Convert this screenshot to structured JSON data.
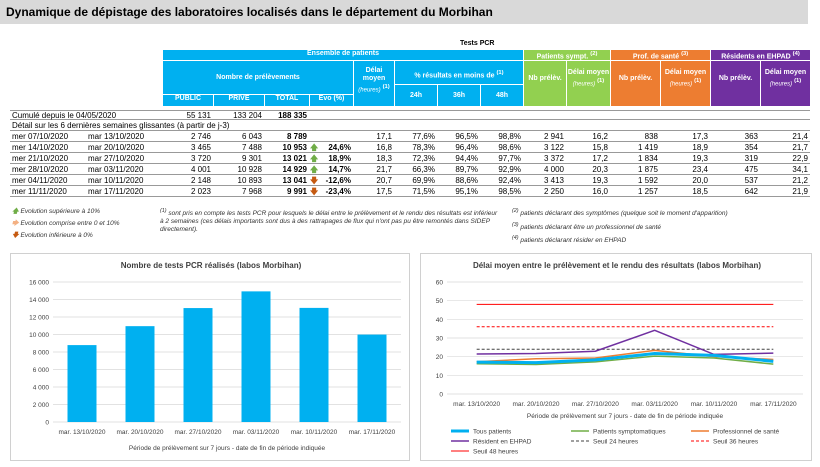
{
  "title": "Dynamique de dépistage des laboratoires localisés dans le département du Morbihan",
  "table": {
    "title": "Tests PCR",
    "groups": {
      "ensemble": "Ensemble de patients",
      "symptomatiques": "Patients sympt.",
      "symptomatiques_sup": "(2)",
      "sante": "Prof. de santé",
      "sante_sup": "(3)",
      "ehpad": "Résidents en EHPAD",
      "ehpad_sup": "(4)"
    },
    "headers": {
      "nb_prelevements": "Nombre de prélèvements",
      "delai": "Délai moyen",
      "heures": "(heures)",
      "sup1": "(1)",
      "pct_moins": "% résultats en moins de",
      "public": "PUBLIC",
      "prive": "PRIVE",
      "total": "TOTAL",
      "evo": "Evo (%)",
      "h24": "24h",
      "h36": "36h",
      "h48": "48h",
      "nb_prelev": "Nb prélèv.",
      "delai_moyen": "Délai moyen"
    },
    "cumul": {
      "label": "Cumulé depuis le 04/05/2020",
      "public": "55 131",
      "prive": "133 204",
      "total": "188 335"
    },
    "detail_label": "Détail sur les 6 dernières semaines glissantes (à partir de j-3)",
    "rows": [
      {
        "from": "mer 07/10/2020",
        "to": "mar 13/10/2020",
        "public": "2 746",
        "prive": "6 043",
        "total": "8 789",
        "evo": "",
        "arrow": "",
        "delai": "17,1",
        "p24": "77,6%",
        "p36": "96,5%",
        "p48": "98,8%",
        "s_nb": "2 941",
        "s_delai": "16,2",
        "ps_nb": "838",
        "ps_delai": "17,3",
        "e_nb": "363",
        "e_delai": "21,4"
      },
      {
        "from": "mer 14/10/2020",
        "to": "mar 20/10/2020",
        "public": "3 465",
        "prive": "7 488",
        "total": "10 953",
        "evo": "24,6%",
        "arrow": "up",
        "delai": "16,8",
        "p24": "78,3%",
        "p36": "96,4%",
        "p48": "98,6%",
        "s_nb": "3 122",
        "s_delai": "15,8",
        "ps_nb": "1 419",
        "ps_delai": "18,9",
        "e_nb": "354",
        "e_delai": "21,7"
      },
      {
        "from": "mer 21/10/2020",
        "to": "mar 27/10/2020",
        "public": "3 720",
        "prive": "9 301",
        "total": "13 021",
        "evo": "18,9%",
        "arrow": "up",
        "delai": "18,3",
        "p24": "72,3%",
        "p36": "94,4%",
        "p48": "97,7%",
        "s_nb": "3 372",
        "s_delai": "17,2",
        "ps_nb": "1 834",
        "ps_delai": "19,3",
        "e_nb": "319",
        "e_delai": "22,9"
      },
      {
        "from": "mer 28/10/2020",
        "to": "mar 03/11/2020",
        "public": "4 001",
        "prive": "10 928",
        "total": "14 929",
        "evo": "14,7%",
        "arrow": "up",
        "delai": "21,7",
        "p24": "66,3%",
        "p36": "89,7%",
        "p48": "92,9%",
        "s_nb": "4 000",
        "s_delai": "20,3",
        "ps_nb": "1 875",
        "ps_delai": "23,4",
        "e_nb": "475",
        "e_delai": "34,1"
      },
      {
        "from": "mer 04/11/2020",
        "to": "mar 10/11/2020",
        "public": "2 148",
        "prive": "10 893",
        "total": "13 041",
        "evo": "-12,6%",
        "arrow": "down",
        "delai": "20,7",
        "p24": "69,9%",
        "p36": "88,6%",
        "p48": "92,4%",
        "s_nb": "3 413",
        "s_delai": "19,3",
        "ps_nb": "1 592",
        "ps_delai": "20,0",
        "e_nb": "537",
        "e_delai": "21,2"
      },
      {
        "from": "mer 11/11/2020",
        "to": "mar 17/11/2020",
        "public": "2 023",
        "prive": "7 968",
        "total": "9 991",
        "evo": "-23,4%",
        "arrow": "down",
        "delai": "17,5",
        "p24": "71,5%",
        "p36": "95,1%",
        "p48": "98,5%",
        "s_nb": "2 250",
        "s_delai": "16,0",
        "ps_nb": "1 257",
        "ps_delai": "18,5",
        "e_nb": "642",
        "e_delai": "21,9"
      }
    ]
  },
  "legend_left": {
    "up": "Evolution supérieure à 10%",
    "mid": "Evolution comprise entre 0 et 10%",
    "down": "Evolution inférieure à 0%"
  },
  "notes": {
    "n1_mark": "(1)",
    "n1": "sont pris en compte les tests PCR pour lesquels le délai entre le prélèvement et le rendu des résultats est inférieur à 2 semaines (ces délais importants sont dus à des rattrapages de flux qui n'ont pas pu être remontés dans SIDEP directement).",
    "n2_mark": "(2)",
    "n2": "patients déclarant des symptômes (quelque soit le moment d'apparition)",
    "n3_mark": "(3)",
    "n3": "patients déclarant être un professionnel de santé",
    "n4_mark": "(4)",
    "n4": "patients déclarant résider en EHPAD"
  },
  "colors": {
    "blue": "#00b0f0",
    "green": "#92d050",
    "orange": "#ed7d31",
    "purple": "#7030a0",
    "bar": "#00b0f0"
  },
  "chart_data": [
    {
      "type": "bar",
      "title": "Nombre de tests PCR réalisés (labos Morbihan)",
      "xlabel": "Période de prélèvement sur 7 jours - date de fin de période indiquée",
      "ylabel": "",
      "categories": [
        "mar. 13/10/2020",
        "mar. 20/10/2020",
        "mar. 27/10/2020",
        "mar. 03/11/2020",
        "mar. 10/11/2020",
        "mar. 17/11/2020"
      ],
      "values": [
        8789,
        10953,
        13021,
        14929,
        13041,
        9991
      ],
      "ylim": [
        0,
        16000
      ],
      "yticks": [
        0,
        2000,
        4000,
        6000,
        8000,
        10000,
        12000,
        14000,
        16000
      ],
      "ytick_labels": [
        "0",
        "2 000",
        "4 000",
        "6 000",
        "8 000",
        "10 000",
        "12 000",
        "14 000",
        "16 000"
      ],
      "grid": true
    },
    {
      "type": "line",
      "title": "Délai moyen entre le prélèvement et le rendu des résultats (labos Morbihan)",
      "xlabel": "Période de prélèvement sur 7 jours - date de fin de période indiquée",
      "ylabel": "",
      "categories": [
        "mar. 13/10/2020",
        "mar. 20/10/2020",
        "mar. 27/10/2020",
        "mar. 03/11/2020",
        "mar. 10/11/2020",
        "mar. 17/11/2020"
      ],
      "ylim": [
        0,
        60
      ],
      "yticks": [
        0,
        10,
        20,
        30,
        40,
        50,
        60
      ],
      "grid": true,
      "legend": "bottom",
      "series": [
        {
          "name": "Tous patients",
          "values": [
            17.1,
            16.8,
            18.3,
            21.7,
            20.7,
            17.5
          ],
          "color": "#00b0f0",
          "style": "solid",
          "width": 3
        },
        {
          "name": "Patients symptomatiques",
          "values": [
            16.2,
            15.8,
            17.2,
            20.3,
            19.3,
            16.0
          ],
          "color": "#70ad47",
          "style": "solid",
          "width": 1.5
        },
        {
          "name": "Professionnel de santé",
          "values": [
            17.3,
            18.9,
            19.3,
            23.4,
            20.0,
            18.5
          ],
          "color": "#ed7d31",
          "style": "solid",
          "width": 1.5
        },
        {
          "name": "Résident en EHPAD",
          "values": [
            21.4,
            21.7,
            22.9,
            34.1,
            21.2,
            21.9
          ],
          "color": "#7030a0",
          "style": "solid",
          "width": 1.5
        },
        {
          "name": "Seuil 24 heures",
          "values": [
            24,
            24,
            24,
            24,
            24,
            24
          ],
          "color": "#404040",
          "style": "dashed",
          "width": 1
        },
        {
          "name": "Seuil 36 heures",
          "values": [
            36,
            36,
            36,
            36,
            36,
            36
          ],
          "color": "#ff0000",
          "style": "dashed",
          "width": 1
        },
        {
          "name": "Seuil 48 heures",
          "values": [
            48,
            48,
            48,
            48,
            48,
            48
          ],
          "color": "#ff0000",
          "style": "solid",
          "width": 1
        }
      ]
    }
  ]
}
